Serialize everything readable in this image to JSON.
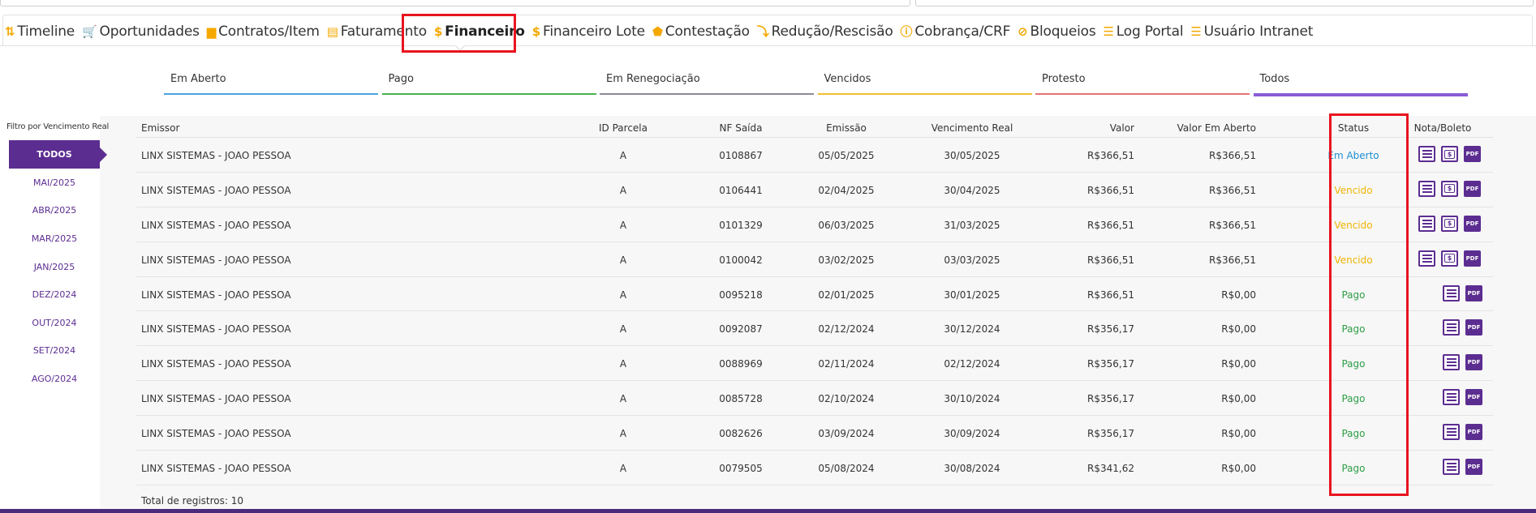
{
  "nav": {
    "tabs": [
      {
        "label": "Timeline",
        "icon": "timeline-icon",
        "glyph": "⇅"
      },
      {
        "label": "Oportunidades",
        "icon": "cart-icon",
        "glyph": "🛒"
      },
      {
        "label": "Contratos/Item",
        "icon": "briefcase-icon",
        "glyph": "▆"
      },
      {
        "label": "Faturamento",
        "icon": "document-icon",
        "glyph": "▤"
      },
      {
        "label": "Financeiro",
        "icon": "dollar-icon",
        "glyph": "$"
      },
      {
        "label": "Financeiro Lote",
        "icon": "dollar-icon",
        "glyph": "$"
      },
      {
        "label": "Contestação",
        "icon": "shield-icon",
        "glyph": "⬟"
      },
      {
        "label": "Redução/Rescisão",
        "icon": "trend-down-icon",
        "glyph": "⤵"
      },
      {
        "label": "Cobrança/CRF",
        "icon": "alert-circle-icon",
        "glyph": "ⓘ"
      },
      {
        "label": "Bloqueios",
        "icon": "block-icon",
        "glyph": "⊘"
      },
      {
        "label": "Log Portal",
        "icon": "list-icon",
        "glyph": "☰"
      },
      {
        "label": "Usuário Intranet",
        "icon": "list-icon",
        "glyph": "☰"
      }
    ],
    "active": "Financeiro"
  },
  "status_tabs": [
    {
      "label": "Em Aberto",
      "color": "#4aa3df"
    },
    {
      "label": "Pago",
      "color": "#4caf50"
    },
    {
      "label": "Em Renegociação",
      "color": "#8a8a9a"
    },
    {
      "label": "Vencidos",
      "color": "#f0c030"
    },
    {
      "label": "Protesto",
      "color": "#e57373"
    },
    {
      "label": "Todos",
      "color": "#8a5cd6"
    }
  ],
  "filter": {
    "title": "Filtro por Vencimento Real",
    "active": "TODOS",
    "items": [
      "MAI/2025",
      "ABR/2025",
      "MAR/2025",
      "JAN/2025",
      "DEZ/2024",
      "OUT/2024",
      "SET/2024",
      "AGO/2024"
    ]
  },
  "table": {
    "headers": {
      "emissor": "Emissor",
      "id_parcela": "ID Parcela",
      "nf_saida": "NF Saída",
      "emissao": "Emissão",
      "vencimento_real": "Vencimento Real",
      "valor": "Valor",
      "valor_em_aberto": "Valor Em Aberto",
      "status": "Status",
      "nota_boleto": "Nota/Boleto"
    },
    "rows": [
      {
        "emissor": "LINX SISTEMAS - JOAO PESSOA",
        "id_parcela": "A",
        "nf_saida": "0108867",
        "emissao": "05/05/2025",
        "vencimento_real": "30/05/2025",
        "valor": "R$366,51",
        "valor_em_aberto": "R$366,51",
        "status": "Em Aberto",
        "status_key": "emaberto",
        "boleto": true
      },
      {
        "emissor": "LINX SISTEMAS - JOAO PESSOA",
        "id_parcela": "A",
        "nf_saida": "0106441",
        "emissao": "02/04/2025",
        "vencimento_real": "30/04/2025",
        "valor": "R$366,51",
        "valor_em_aberto": "R$366,51",
        "status": "Vencido",
        "status_key": "vencido",
        "boleto": true
      },
      {
        "emissor": "LINX SISTEMAS - JOAO PESSOA",
        "id_parcela": "A",
        "nf_saida": "0101329",
        "emissao": "06/03/2025",
        "vencimento_real": "31/03/2025",
        "valor": "R$366,51",
        "valor_em_aberto": "R$366,51",
        "status": "Vencido",
        "status_key": "vencido",
        "boleto": true
      },
      {
        "emissor": "LINX SISTEMAS - JOAO PESSOA",
        "id_parcela": "A",
        "nf_saida": "0100042",
        "emissao": "03/02/2025",
        "vencimento_real": "03/03/2025",
        "valor": "R$366,51",
        "valor_em_aberto": "R$366,51",
        "status": "Vencido",
        "status_key": "vencido",
        "boleto": true
      },
      {
        "emissor": "LINX SISTEMAS - JOAO PESSOA",
        "id_parcela": "A",
        "nf_saida": "0095218",
        "emissao": "02/01/2025",
        "vencimento_real": "30/01/2025",
        "valor": "R$366,51",
        "valor_em_aberto": "R$0,00",
        "status": "Pago",
        "status_key": "pago",
        "boleto": false
      },
      {
        "emissor": "LINX SISTEMAS - JOAO PESSOA",
        "id_parcela": "A",
        "nf_saida": "0092087",
        "emissao": "02/12/2024",
        "vencimento_real": "30/12/2024",
        "valor": "R$356,17",
        "valor_em_aberto": "R$0,00",
        "status": "Pago",
        "status_key": "pago",
        "boleto": false
      },
      {
        "emissor": "LINX SISTEMAS - JOAO PESSOA",
        "id_parcela": "A",
        "nf_saida": "0088969",
        "emissao": "02/11/2024",
        "vencimento_real": "02/12/2024",
        "valor": "R$356,17",
        "valor_em_aberto": "R$0,00",
        "status": "Pago",
        "status_key": "pago",
        "boleto": false
      },
      {
        "emissor": "LINX SISTEMAS - JOAO PESSOA",
        "id_parcela": "A",
        "nf_saida": "0085728",
        "emissao": "02/10/2024",
        "vencimento_real": "30/10/2024",
        "valor": "R$356,17",
        "valor_em_aberto": "R$0,00",
        "status": "Pago",
        "status_key": "pago",
        "boleto": false
      },
      {
        "emissor": "LINX SISTEMAS - JOAO PESSOA",
        "id_parcela": "A",
        "nf_saida": "0082626",
        "emissao": "03/09/2024",
        "vencimento_real": "30/09/2024",
        "valor": "R$356,17",
        "valor_em_aberto": "R$0,00",
        "status": "Pago",
        "status_key": "pago",
        "boleto": false
      },
      {
        "emissor": "LINX SISTEMAS - JOAO PESSOA",
        "id_parcela": "A",
        "nf_saida": "0079505",
        "emissao": "05/08/2024",
        "vencimento_real": "30/08/2024",
        "valor": "R$341,62",
        "valor_em_aberto": "R$0,00",
        "status": "Pago",
        "status_key": "pago",
        "boleto": false
      }
    ],
    "total_label": "Total de registros: 10"
  },
  "icons": {
    "nota": "document-icon",
    "boleto": "boleto-icon",
    "pdf": "pdf-icon",
    "pdf_text": "PDF",
    "boleto_text": "$"
  },
  "colors": {
    "accent": "#5c2d91",
    "highlight": "#e8141e",
    "em_aberto": "#1b8fd1",
    "vencido": "#f0b400",
    "pago": "#2e9d45"
  }
}
